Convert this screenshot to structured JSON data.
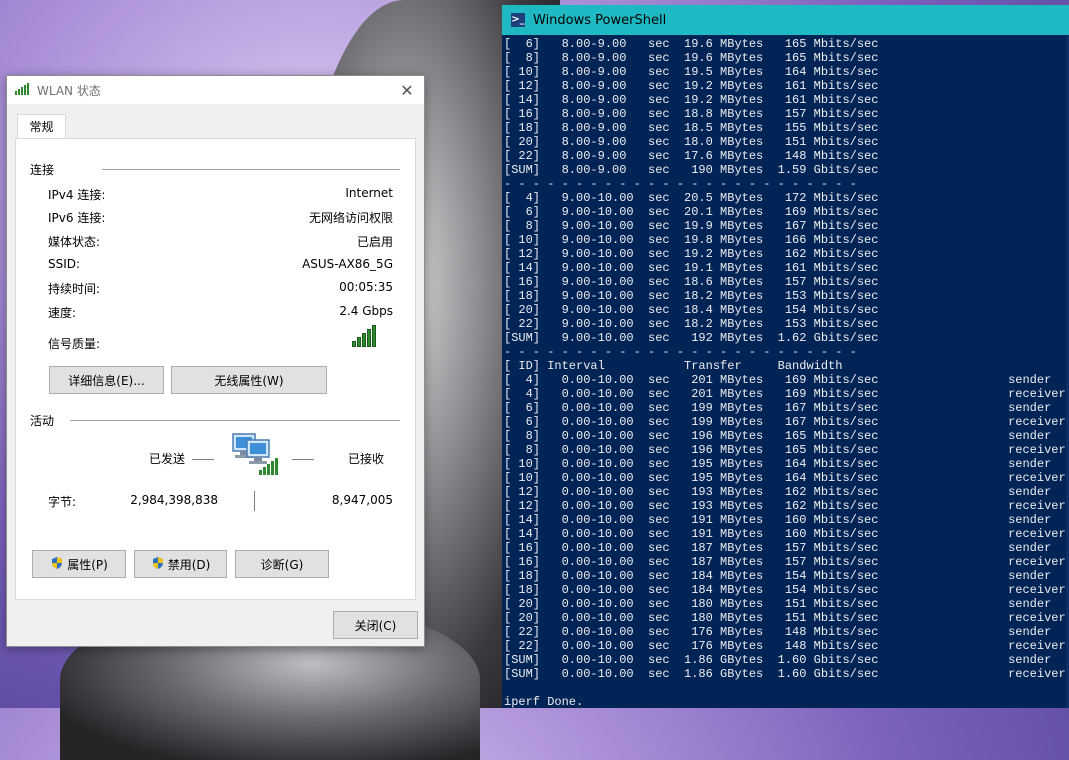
{
  "dialog": {
    "title": "WLAN 状态",
    "tab": "常规",
    "connection_section": "连接",
    "rows": [
      {
        "label": "IPv4 连接:",
        "value": "Internet"
      },
      {
        "label": "IPv6 连接:",
        "value": "无网络访问权限"
      },
      {
        "label": "媒体状态:",
        "value": "已启用"
      },
      {
        "label": "SSID:",
        "value": "ASUS-AX86_5G"
      },
      {
        "label": "持续时间:",
        "value": "00:05:35"
      },
      {
        "label": "速度:",
        "value": "2.4 Gbps"
      }
    ],
    "signal_label": "信号质量:",
    "signal_bars": 5,
    "details_button": "详细信息(E)...",
    "wireless_props_button": "无线属性(W)",
    "activity_section": "活动",
    "sent_label": "已发送",
    "received_label": "已接收",
    "bytes_label": "字节:",
    "bytes_sent": "2,984,398,838",
    "bytes_received": "8,947,005",
    "properties_button": "属性(P)",
    "disable_button": "禁用(D)",
    "diagnose_button": "诊断(G)",
    "close_button": "关闭(C)"
  },
  "powershell": {
    "title": "Windows PowerShell",
    "lines": [
      "[  6]   8.00-9.00   sec  19.6 MBytes   165 Mbits/sec",
      "[  8]   8.00-9.00   sec  19.6 MBytes   165 Mbits/sec",
      "[ 10]   8.00-9.00   sec  19.5 MBytes   164 Mbits/sec",
      "[ 12]   8.00-9.00   sec  19.2 MBytes   161 Mbits/sec",
      "[ 14]   8.00-9.00   sec  19.2 MBytes   161 Mbits/sec",
      "[ 16]   8.00-9.00   sec  18.8 MBytes   157 Mbits/sec",
      "[ 18]   8.00-9.00   sec  18.5 MBytes   155 Mbits/sec",
      "[ 20]   8.00-9.00   sec  18.0 MBytes   151 Mbits/sec",
      "[ 22]   8.00-9.00   sec  17.6 MBytes   148 Mbits/sec",
      "[SUM]   8.00-9.00   sec   190 MBytes  1.59 Gbits/sec",
      "- - - - - - - - - - - - - - - - - - - - - - - - -",
      "[  4]   9.00-10.00  sec  20.5 MBytes   172 Mbits/sec",
      "[  6]   9.00-10.00  sec  20.1 MBytes   169 Mbits/sec",
      "[  8]   9.00-10.00  sec  19.9 MBytes   167 Mbits/sec",
      "[ 10]   9.00-10.00  sec  19.8 MBytes   166 Mbits/sec",
      "[ 12]   9.00-10.00  sec  19.2 MBytes   162 Mbits/sec",
      "[ 14]   9.00-10.00  sec  19.1 MBytes   161 Mbits/sec",
      "[ 16]   9.00-10.00  sec  18.6 MBytes   157 Mbits/sec",
      "[ 18]   9.00-10.00  sec  18.2 MBytes   153 Mbits/sec",
      "[ 20]   9.00-10.00  sec  18.4 MBytes   154 Mbits/sec",
      "[ 22]   9.00-10.00  sec  18.2 MBytes   153 Mbits/sec",
      "[SUM]   9.00-10.00  sec   192 MBytes  1.62 Gbits/sec",
      "- - - - - - - - - - - - - - - - - - - - - - - - -",
      "[ ID] Interval           Transfer     Bandwidth",
      "[  4]   0.00-10.00  sec   201 MBytes   169 Mbits/sec                  sender",
      "[  4]   0.00-10.00  sec   201 MBytes   169 Mbits/sec                  receiver",
      "[  6]   0.00-10.00  sec   199 MBytes   167 Mbits/sec                  sender",
      "[  6]   0.00-10.00  sec   199 MBytes   167 Mbits/sec                  receiver",
      "[  8]   0.00-10.00  sec   196 MBytes   165 Mbits/sec                  sender",
      "[  8]   0.00-10.00  sec   196 MBytes   165 Mbits/sec                  receiver",
      "[ 10]   0.00-10.00  sec   195 MBytes   164 Mbits/sec                  sender",
      "[ 10]   0.00-10.00  sec   195 MBytes   164 Mbits/sec                  receiver",
      "[ 12]   0.00-10.00  sec   193 MBytes   162 Mbits/sec                  sender",
      "[ 12]   0.00-10.00  sec   193 MBytes   162 Mbits/sec                  receiver",
      "[ 14]   0.00-10.00  sec   191 MBytes   160 Mbits/sec                  sender",
      "[ 14]   0.00-10.00  sec   191 MBytes   160 Mbits/sec                  receiver",
      "[ 16]   0.00-10.00  sec   187 MBytes   157 Mbits/sec                  sender",
      "[ 16]   0.00-10.00  sec   187 MBytes   157 Mbits/sec                  receiver",
      "[ 18]   0.00-10.00  sec   184 MBytes   154 Mbits/sec                  sender",
      "[ 18]   0.00-10.00  sec   184 MBytes   154 Mbits/sec                  receiver",
      "[ 20]   0.00-10.00  sec   180 MBytes   151 Mbits/sec                  sender",
      "[ 20]   0.00-10.00  sec   180 MBytes   151 Mbits/sec                  receiver",
      "[ 22]   0.00-10.00  sec   176 MBytes   148 Mbits/sec                  sender",
      "[ 22]   0.00-10.00  sec   176 MBytes   148 Mbits/sec                  receiver",
      "[SUM]   0.00-10.00  sec  1.86 GBytes  1.60 Gbits/sec                  sender",
      "[SUM]   0.00-10.00  sec  1.86 GBytes  1.60 Gbits/sec                  receiver",
      "",
      "iperf Done."
    ]
  }
}
